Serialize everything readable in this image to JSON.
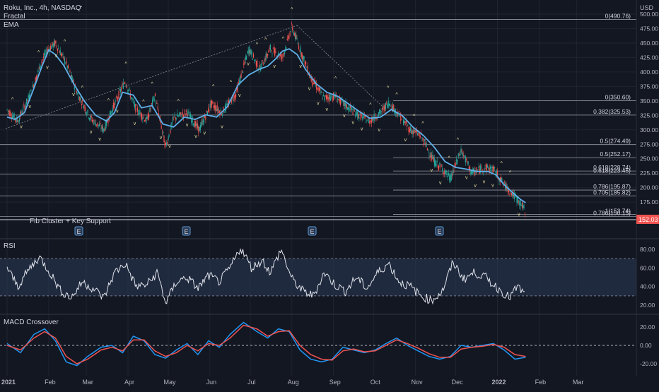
{
  "colors": {
    "background": "#131722",
    "grid": "#1f2430",
    "candle_up": "#26a69a",
    "candle_down": "#ef5350",
    "ema": "#5fb0e8",
    "fib_line": "#b2b5be",
    "text": "#d1d4dc",
    "axis_text": "#b2b5be",
    "price_tag": "#ef5350",
    "rsi_line": "#e0e3eb",
    "rsi_band": "#2a3a55",
    "macd_line": "#2196f3",
    "signal_line": "#ef5350",
    "fractal": "#e8e0a0"
  },
  "header": {
    "title": "Roku, Inc., 4h, NASDAQ",
    "indicators": [
      "Fractal",
      "EMA"
    ],
    "currency": "USD"
  },
  "price_tag": "152.03",
  "annotation": "Fib Cluster + Key Support",
  "earnings_marker": "E",
  "rsi_label": "RSI",
  "macd_label": "MACD Crossover",
  "chart_data": [
    {
      "type": "candlestick",
      "ylim": [
        140,
        512
      ],
      "yticks": [
        "500.00",
        "475.00",
        "450.00",
        "425.00",
        "400.00",
        "375.00",
        "350.00",
        "325.00",
        "300.00",
        "275.00",
        "250.00",
        "225.00",
        "200.00",
        "175.00",
        "152.03"
      ],
      "ytick_values": [
        500,
        475,
        450,
        425,
        400,
        375,
        350,
        325,
        300,
        275,
        250,
        225,
        200,
        175
      ],
      "xticks": [
        "2021",
        "Feb",
        "Mar",
        "Apr",
        "May",
        "Jun",
        "Jul",
        "Aug",
        "Sep",
        "Oct",
        "Nov",
        "Dec",
        "2022",
        "Feb",
        "Mar"
      ],
      "xtick_days": [
        0,
        31,
        59,
        90,
        120,
        151,
        181,
        212,
        243,
        273,
        304,
        334,
        365,
        396,
        424
      ],
      "x_start": "2021-01-01",
      "price_path": [
        [
          0,
          335
        ],
        [
          8,
          315
        ],
        [
          18,
          365
        ],
        [
          26,
          420
        ],
        [
          31,
          440
        ],
        [
          36,
          450
        ],
        [
          44,
          415
        ],
        [
          52,
          365
        ],
        [
          62,
          320
        ],
        [
          72,
          300
        ],
        [
          80,
          345
        ],
        [
          88,
          385
        ],
        [
          95,
          340
        ],
        [
          104,
          315
        ],
        [
          110,
          360
        ],
        [
          118,
          270
        ],
        [
          124,
          320
        ],
        [
          134,
          330
        ],
        [
          143,
          300
        ],
        [
          152,
          345
        ],
        [
          160,
          330
        ],
        [
          170,
          360
        ],
        [
          180,
          440
        ],
        [
          188,
          405
        ],
        [
          196,
          440
        ],
        [
          205,
          425
        ],
        [
          212,
          478
        ],
        [
          218,
          440
        ],
        [
          226,
          390
        ],
        [
          236,
          355
        ],
        [
          244,
          358
        ],
        [
          253,
          340
        ],
        [
          262,
          325
        ],
        [
          270,
          315
        ],
        [
          278,
          330
        ],
        [
          284,
          347
        ],
        [
          292,
          325
        ],
        [
          300,
          300
        ],
        [
          308,
          290
        ],
        [
          318,
          245
        ],
        [
          325,
          230
        ],
        [
          330,
          215
        ],
        [
          338,
          265
        ],
        [
          346,
          225
        ],
        [
          355,
          235
        ],
        [
          362,
          232
        ],
        [
          370,
          205
        ],
        [
          376,
          190
        ],
        [
          383,
          170
        ],
        [
          386,
          157
        ]
      ],
      "ema_path": [
        [
          0,
          322
        ],
        [
          6,
          318
        ],
        [
          13,
          330
        ],
        [
          20,
          372
        ],
        [
          26,
          410
        ],
        [
          31,
          438
        ],
        [
          36,
          430
        ],
        [
          42,
          412
        ],
        [
          50,
          378
        ],
        [
          58,
          348
        ],
        [
          66,
          325
        ],
        [
          74,
          315
        ],
        [
          80,
          330
        ],
        [
          86,
          365
        ],
        [
          94,
          360
        ],
        [
          100,
          338
        ],
        [
          108,
          342
        ],
        [
          116,
          310
        ],
        [
          124,
          305
        ],
        [
          132,
          322
        ],
        [
          140,
          318
        ],
        [
          148,
          326
        ],
        [
          156,
          322
        ],
        [
          164,
          340
        ],
        [
          172,
          378
        ],
        [
          180,
          395
        ],
        [
          188,
          405
        ],
        [
          194,
          410
        ],
        [
          200,
          423
        ],
        [
          205,
          436
        ],
        [
          210,
          440
        ],
        [
          216,
          430
        ],
        [
          222,
          405
        ],
        [
          230,
          380
        ],
        [
          238,
          365
        ],
        [
          246,
          358
        ],
        [
          254,
          345
        ],
        [
          262,
          332
        ],
        [
          270,
          320
        ],
        [
          278,
          322
        ],
        [
          286,
          335
        ],
        [
          294,
          325
        ],
        [
          302,
          305
        ],
        [
          310,
          290
        ],
        [
          318,
          270
        ],
        [
          326,
          245
        ],
        [
          334,
          235
        ],
        [
          342,
          232
        ],
        [
          350,
          228
        ],
        [
          358,
          228
        ],
        [
          364,
          222
        ],
        [
          370,
          205
        ],
        [
          376,
          192
        ],
        [
          382,
          180
        ],
        [
          386,
          174
        ]
      ],
      "fib_levels": [
        {
          "label": "0(490.76)",
          "value": 490.76
        },
        {
          "label": "0(350.60)",
          "value": 350.6
        },
        {
          "label": "0.382(325.53)",
          "value": 325.53
        },
        {
          "label": "0.5(274.49)",
          "value": 274.49
        },
        {
          "label": "0.5(252.17)",
          "value": 252.17
        },
        {
          "label": "0.618(228.74)",
          "value": 228.74
        },
        {
          "label": "0.618(223.45)",
          "value": 223.45
        },
        {
          "label": "0.786(195.87)",
          "value": 195.87
        },
        {
          "label": "0.705(185.82)",
          "value": 185.82
        },
        {
          "label": "1(153.74)",
          "value": 153.74
        },
        {
          "label": "0.786(150.15)",
          "value": 150.15
        }
      ]
    },
    {
      "type": "line",
      "name": "RSI",
      "ylim": [
        15,
        90
      ],
      "yticks": [
        "80.00",
        "60.00",
        "40.00",
        "20.00"
      ],
      "ytick_values": [
        80,
        60,
        40,
        20
      ],
      "band": [
        30,
        70
      ],
      "path": [
        [
          0,
          60
        ],
        [
          8,
          40
        ],
        [
          16,
          58
        ],
        [
          24,
          72
        ],
        [
          32,
          55
        ],
        [
          40,
          35
        ],
        [
          48,
          28
        ],
        [
          56,
          45
        ],
        [
          64,
          38
        ],
        [
          72,
          28
        ],
        [
          80,
          55
        ],
        [
          88,
          65
        ],
        [
          96,
          40
        ],
        [
          104,
          42
        ],
        [
          112,
          55
        ],
        [
          118,
          22
        ],
        [
          126,
          45
        ],
        [
          134,
          50
        ],
        [
          142,
          38
        ],
        [
          150,
          52
        ],
        [
          158,
          45
        ],
        [
          166,
          60
        ],
        [
          174,
          82
        ],
        [
          182,
          60
        ],
        [
          190,
          68
        ],
        [
          196,
          55
        ],
        [
          204,
          80
        ],
        [
          212,
          48
        ],
        [
          220,
          35
        ],
        [
          228,
          30
        ],
        [
          236,
          55
        ],
        [
          244,
          42
        ],
        [
          252,
          35
        ],
        [
          260,
          50
        ],
        [
          268,
          38
        ],
        [
          276,
          55
        ],
        [
          284,
          65
        ],
        [
          292,
          45
        ],
        [
          300,
          40
        ],
        [
          308,
          30
        ],
        [
          316,
          25
        ],
        [
          324,
          35
        ],
        [
          332,
          66
        ],
        [
          340,
          48
        ],
        [
          348,
          55
        ],
        [
          356,
          50
        ],
        [
          362,
          42
        ],
        [
          368,
          35
        ],
        [
          374,
          28
        ],
        [
          380,
          40
        ],
        [
          386,
          30
        ]
      ]
    },
    {
      "type": "line",
      "name": "MACD Crossover",
      "ylim": [
        -26,
        26
      ],
      "yticks": [
        "20.00",
        "0.00",
        "-20.00"
      ],
      "ytick_values": [
        20,
        0,
        -20
      ],
      "series": [
        {
          "path": [
            [
              0,
              2
            ],
            [
              10,
              -8
            ],
            [
              20,
              12
            ],
            [
              28,
              18
            ],
            [
              36,
              5
            ],
            [
              44,
              -18
            ],
            [
              52,
              -22
            ],
            [
              60,
              -12
            ],
            [
              70,
              -2
            ],
            [
              78,
              0
            ],
            [
              86,
              -8
            ],
            [
              94,
              10
            ],
            [
              102,
              5
            ],
            [
              110,
              -10
            ],
            [
              118,
              -14
            ],
            [
              126,
              -5
            ],
            [
              134,
              2
            ],
            [
              142,
              -10
            ],
            [
              150,
              5
            ],
            [
              158,
              -2
            ],
            [
              166,
              12
            ],
            [
              176,
              25
            ],
            [
              186,
              15
            ],
            [
              194,
              8
            ],
            [
              202,
              18
            ],
            [
              210,
              15
            ],
            [
              218,
              -5
            ],
            [
              226,
              -15
            ],
            [
              234,
              -18
            ],
            [
              242,
              -15
            ],
            [
              250,
              -2
            ],
            [
              258,
              -5
            ],
            [
              266,
              -8
            ],
            [
              274,
              -5
            ],
            [
              282,
              2
            ],
            [
              290,
              8
            ],
            [
              298,
              0
            ],
            [
              306,
              -6
            ],
            [
              314,
              -12
            ],
            [
              322,
              -15
            ],
            [
              330,
              -12
            ],
            [
              338,
              0
            ],
            [
              346,
              -2
            ],
            [
              354,
              0
            ],
            [
              362,
              2
            ],
            [
              370,
              -5
            ],
            [
              378,
              -15
            ],
            [
              386,
              -13
            ]
          ]
        },
        {
          "path": [
            [
              0,
              0
            ],
            [
              10,
              -5
            ],
            [
              20,
              8
            ],
            [
              28,
              15
            ],
            [
              36,
              8
            ],
            [
              44,
              -12
            ],
            [
              52,
              -20
            ],
            [
              60,
              -15
            ],
            [
              70,
              -5
            ],
            [
              78,
              -2
            ],
            [
              86,
              -6
            ],
            [
              94,
              6
            ],
            [
              102,
              6
            ],
            [
              110,
              -6
            ],
            [
              118,
              -12
            ],
            [
              126,
              -8
            ],
            [
              134,
              0
            ],
            [
              142,
              -6
            ],
            [
              150,
              2
            ],
            [
              158,
              0
            ],
            [
              166,
              8
            ],
            [
              176,
              22
            ],
            [
              186,
              18
            ],
            [
              194,
              10
            ],
            [
              202,
              15
            ],
            [
              210,
              16
            ],
            [
              218,
              0
            ],
            [
              226,
              -10
            ],
            [
              234,
              -15
            ],
            [
              242,
              -16
            ],
            [
              250,
              -6
            ],
            [
              258,
              -4
            ],
            [
              266,
              -7
            ],
            [
              274,
              -6
            ],
            [
              282,
              0
            ],
            [
              290,
              6
            ],
            [
              298,
              2
            ],
            [
              306,
              -3
            ],
            [
              314,
              -9
            ],
            [
              322,
              -13
            ],
            [
              330,
              -13
            ],
            [
              338,
              -4
            ],
            [
              346,
              -2
            ],
            [
              354,
              -1
            ],
            [
              362,
              1
            ],
            [
              370,
              -2
            ],
            [
              378,
              -10
            ],
            [
              386,
              -12
            ]
          ]
        }
      ]
    }
  ]
}
